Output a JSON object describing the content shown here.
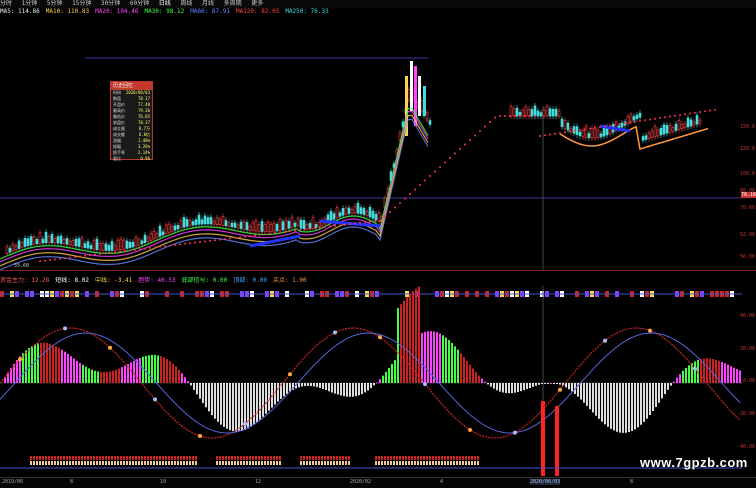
{
  "toolbar": {
    "items": [
      "分时",
      "1分钟",
      "5分钟",
      "15分钟",
      "30分钟",
      "60分钟",
      "日线",
      "周线",
      "月线",
      "多周期",
      "更多"
    ]
  },
  "main_indicator_bar": {
    "items": [
      {
        "text": "MA5: 114.86",
        "color": "#e8e8e8"
      },
      {
        "text": "MA10: 110.83",
        "color": "#ffd24d"
      },
      {
        "text": "MA20: 104.46",
        "color": "#ff44ff"
      },
      {
        "text": "MA30: 98.12",
        "color": "#44ff44"
      },
      {
        "text": "MA60: 87.91",
        "color": "#6688ff"
      },
      {
        "text": "MA120: 82.05",
        "color": "#ff4444"
      },
      {
        "text": "MA250: 76.33",
        "color": "#44dddd"
      }
    ]
  },
  "tooltip": {
    "title": "历史回忆",
    "rows": [
      {
        "k": "时间",
        "v": "2020/06/03"
      },
      {
        "k": "数值",
        "v": "78.17"
      },
      {
        "k": "开盘价",
        "v": "77.40"
      },
      {
        "k": "最高价",
        "v": "79.36"
      },
      {
        "k": "最低价",
        "v": "76.85"
      },
      {
        "k": "收盘价",
        "v": "78.17"
      },
      {
        "k": "成交量",
        "v": "8.7万"
      },
      {
        "k": "成交额",
        "v": "6.8亿"
      },
      {
        "k": "涨幅",
        "v": "1.48%"
      },
      {
        "k": "振幅",
        "v": "3.26%"
      },
      {
        "k": "换手率",
        "v": "2.14%"
      },
      {
        "k": "量比",
        "v": "0.96"
      }
    ]
  },
  "price_axis": [
    "150.0",
    "120.0",
    "100.0",
    "88.00",
    "78.16",
    "70.00",
    "62.00",
    "56.00"
  ],
  "low_price_label": "55.60",
  "sub_indicator_bar": {
    "items": [
      {
        "text": "资金主力: 12.28",
        "color": "#ff5555"
      },
      {
        "text": "短线: 8.02",
        "color": "#ffffff"
      },
      {
        "text": "中线: -3.41",
        "color": "#ffd24d"
      },
      {
        "text": "趋势: 46.53",
        "color": "#ff44ff"
      },
      {
        "text": "底部信号: 0.00",
        "color": "#44ff44"
      },
      {
        "text": "顶部: 0.00",
        "color": "#44aaff"
      },
      {
        "text": "买点: 1.00",
        "color": "#ff9944"
      }
    ]
  },
  "sub_axis": [
    "40.00",
    "20.00",
    "0.00",
    "-20.00",
    "-40.00"
  ],
  "bottom_axis": [
    "2019/06",
    "8",
    "10",
    "12",
    "2020/02",
    "4",
    "2020/06/03",
    "8"
  ],
  "watermark": "www.7gpzb.com"
}
